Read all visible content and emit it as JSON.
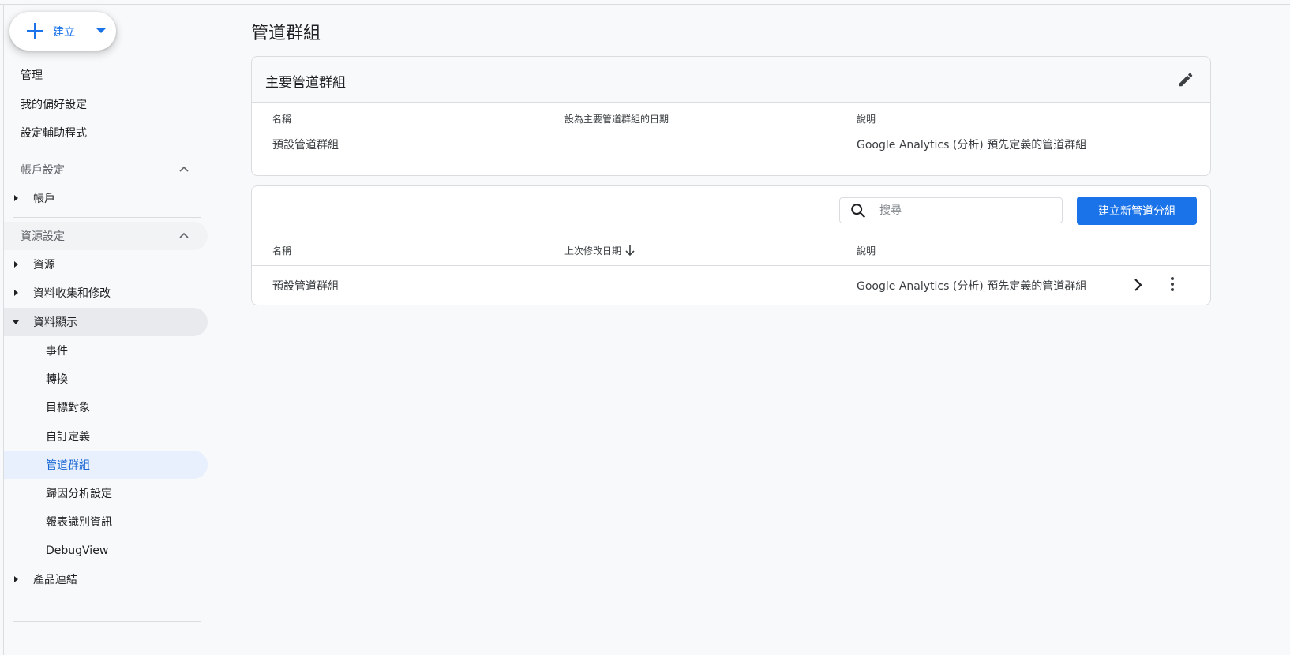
{
  "sidebar": {
    "create_label": "建立",
    "top_items": [
      {
        "label": "管理"
      },
      {
        "label": "我的偏好設定"
      },
      {
        "label": "設定輔助程式"
      }
    ],
    "account_section": {
      "label": "帳戶設定",
      "items": [
        {
          "label": "帳戶"
        }
      ]
    },
    "property_section": {
      "label": "資源設定",
      "items": [
        {
          "label": "資源"
        },
        {
          "label": "資料收集和修改"
        },
        {
          "label": "資料顯示"
        },
        {
          "label": "產品連結"
        }
      ],
      "data_display_children": [
        {
          "label": "事件"
        },
        {
          "label": "轉換"
        },
        {
          "label": "目標對象"
        },
        {
          "label": "自訂定義"
        },
        {
          "label": "管道群組"
        },
        {
          "label": "歸因分析設定"
        },
        {
          "label": "報表識別資訊"
        },
        {
          "label": "DebugView"
        }
      ]
    }
  },
  "main": {
    "title": "管道群組",
    "primary_card": {
      "title": "主要管道群組",
      "columns": [
        "名稱",
        "設為主要管道群組的日期",
        "說明"
      ],
      "row": {
        "name": "預設管道群組",
        "date": "",
        "description": "Google Analytics (分析) 預先定義的管道群組"
      }
    },
    "list_card": {
      "search_placeholder": "搜尋",
      "create_button": "建立新管道分組",
      "columns": [
        "名稱",
        "上次修改日期",
        "說明"
      ],
      "rows": [
        {
          "name": "預設管道群組",
          "modified": "",
          "description": "Google Analytics (分析) 預先定義的管道群組"
        }
      ]
    }
  },
  "colors": {
    "accent": "#1a73e8",
    "active_bg": "#e8f0fe",
    "border": "#dadce0"
  }
}
